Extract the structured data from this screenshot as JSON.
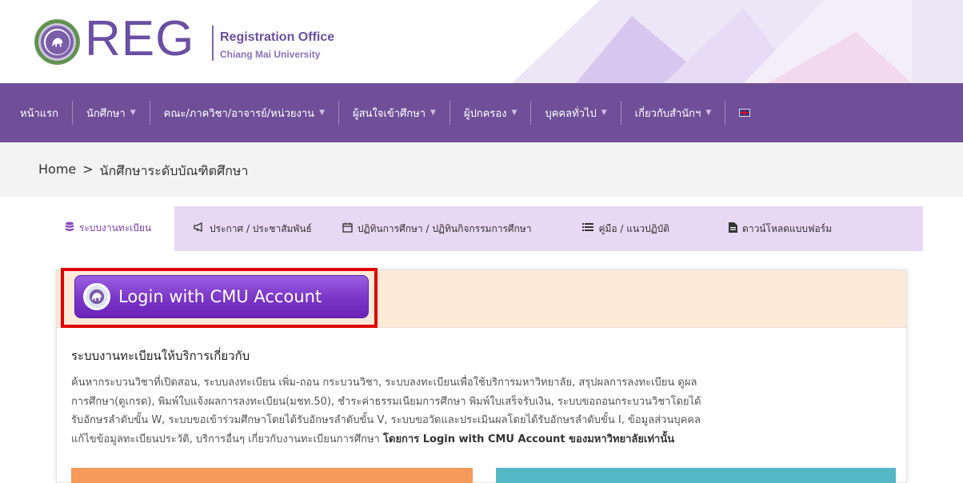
{
  "header": {
    "logo_text": "REG",
    "subtitle_line1": "Registration Office",
    "subtitle_line2": "Chiang Mai University"
  },
  "nav": {
    "items": [
      {
        "label": "หน้าแรก",
        "dropdown": false
      },
      {
        "label": "นักศึกษา",
        "dropdown": true
      },
      {
        "label": "คณะ/ภาควิชา/อาจารย์/หน่วยงาน",
        "dropdown": true
      },
      {
        "label": "ผู้สนใจเข้าศึกษา",
        "dropdown": true
      },
      {
        "label": "ผู้ปกครอง",
        "dropdown": true
      },
      {
        "label": "บุคคลทั่วไป",
        "dropdown": true
      },
      {
        "label": "เกี่ยวกับสำนักฯ",
        "dropdown": true
      }
    ],
    "language_icon": "uk-flag-icon"
  },
  "breadcrumb": {
    "home": "Home",
    "separator": ">",
    "current": "นักศึกษาระดับบัณฑิตศึกษา"
  },
  "tabs": [
    {
      "label": "ระบบงานทะเบียน",
      "icon": "database-icon",
      "active": true
    },
    {
      "label": "ประกาศ / ประชาสัมพันธ์",
      "icon": "megaphone-icon",
      "active": false
    },
    {
      "label": "ปฏิทินการศึกษา / ปฏิทินกิจกรรมการศึกษา",
      "icon": "calendar-icon",
      "active": false
    },
    {
      "label": "คู่มือ / แนวปฏิบัติ",
      "icon": "list-icon",
      "active": false
    },
    {
      "label": "ดาวน์โหลดแบบฟอร์ม",
      "icon": "file-icon",
      "active": false
    }
  ],
  "login": {
    "button_label": "Login with CMU Account"
  },
  "content": {
    "title": "ระบบงานทะเบียนให้บริการเกี่ยวกับ",
    "lines": [
      "ค้นหากระบวนวิชาที่เปิดสอน, ระบบลงทะเบียน เพิ่ม-ถอน กระบวนวิชา, ระบบลงทะเบียนเพื่อใช้บริการมหาวิทยาลัย, สรุปผลการลงทะเบียน ดูผล",
      "การศึกษา(ดูเกรด), พิมพ์ใบแจ้งผลการลงทะเบียน(มชท.50), ชำระค่าธรรมเนียมการศึกษา พิมพ์ใบเสร็จรับเงิน, ระบบขอถอนกระบวนวิชาโดยได้",
      "รับอักษรลำดับขั้น W, ระบบขอเข้าร่วมศึกษาโดยได้รับอักษรลำดับขั้น V, ระบบขอวัดและประเมินผลโดยได้รับอักษรลำดับขั้น I, ข้อมูลส่วนบุคคล",
      "แก้ไขข้อมูลทะเบียนประวัติ, บริการอื่นๆ เกี่ยวกับงานทะเบียนการศึกษา"
    ],
    "emphasis": "โดยการ Login with CMU Account ของมหาวิทยาลัยเท่านั้น"
  },
  "colors": {
    "nav_bg": "#6f4f98",
    "accent_purple": "#7a35c8",
    "highlight_red": "#e00000",
    "panel_head_bg": "#fde9d8",
    "tabs_bg": "#e8d8f3"
  }
}
